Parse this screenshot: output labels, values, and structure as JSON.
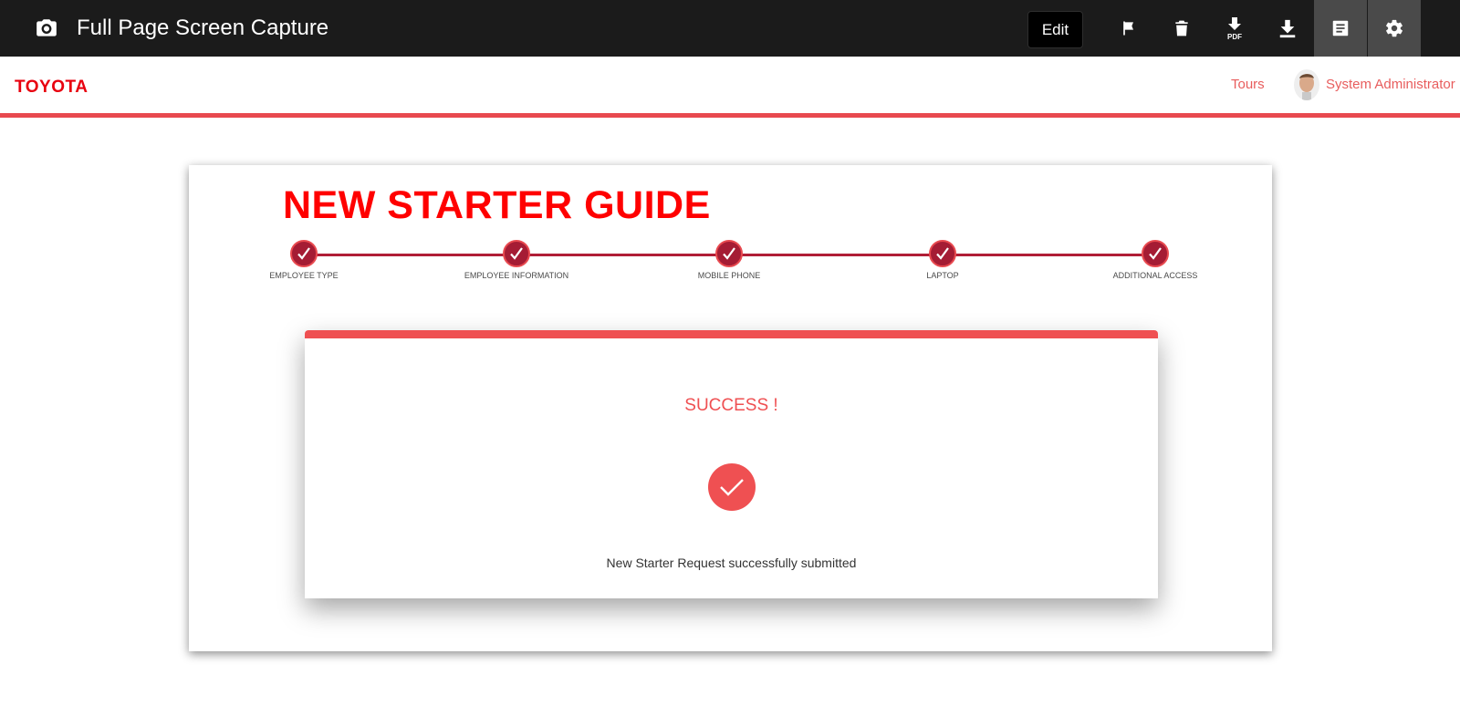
{
  "capture_toolbar": {
    "title": "Full Page Screen Capture",
    "edit_label": "Edit",
    "icons": [
      "camera-icon",
      "flag-icon",
      "trash-icon",
      "download-pdf-icon",
      "download-icon",
      "notes-icon",
      "gear-icon"
    ],
    "pdf_label": "PDF"
  },
  "app_header": {
    "logo": "TOYOTA",
    "tours": "Tours",
    "user": "System Administrator",
    "accent_color": "#e8494f"
  },
  "guide": {
    "title": "NEW STARTER GUIDE",
    "title_color": "#ff0000",
    "steps": [
      {
        "label": "EMPLOYEE TYPE",
        "completed": true
      },
      {
        "label": "EMPLOYEE INFORMATION",
        "completed": true
      },
      {
        "label": "MOBILE PHONE",
        "completed": true
      },
      {
        "label": "LAPTOP",
        "completed": true
      },
      {
        "label": "ADDITIONAL ACCESS",
        "completed": true
      }
    ],
    "step_color": "#a51c34"
  },
  "result": {
    "heading": "SUCCESS !",
    "message": "New Starter Request successfully submitted",
    "accent_color": "#ef5052"
  }
}
